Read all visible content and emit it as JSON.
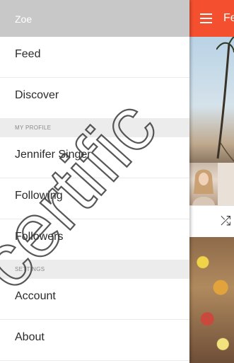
{
  "drawer": {
    "header_title": "Zoe",
    "items_top": [
      {
        "label": "Feed"
      },
      {
        "label": "Discover"
      }
    ],
    "section_profile": "MY PROFILE",
    "items_profile": [
      {
        "label": "Jennifer Singer"
      },
      {
        "label": "Following"
      },
      {
        "label": "Followers"
      }
    ],
    "section_settings": "SETTINGS",
    "items_settings": [
      {
        "label": "Account"
      },
      {
        "label": "About"
      }
    ]
  },
  "app": {
    "header_title": "Feed",
    "accent_color": "#f4502f"
  },
  "icons": {
    "menu": "hamburger-menu-icon",
    "shuffle": "shuffle-icon"
  },
  "watermark": "certific"
}
